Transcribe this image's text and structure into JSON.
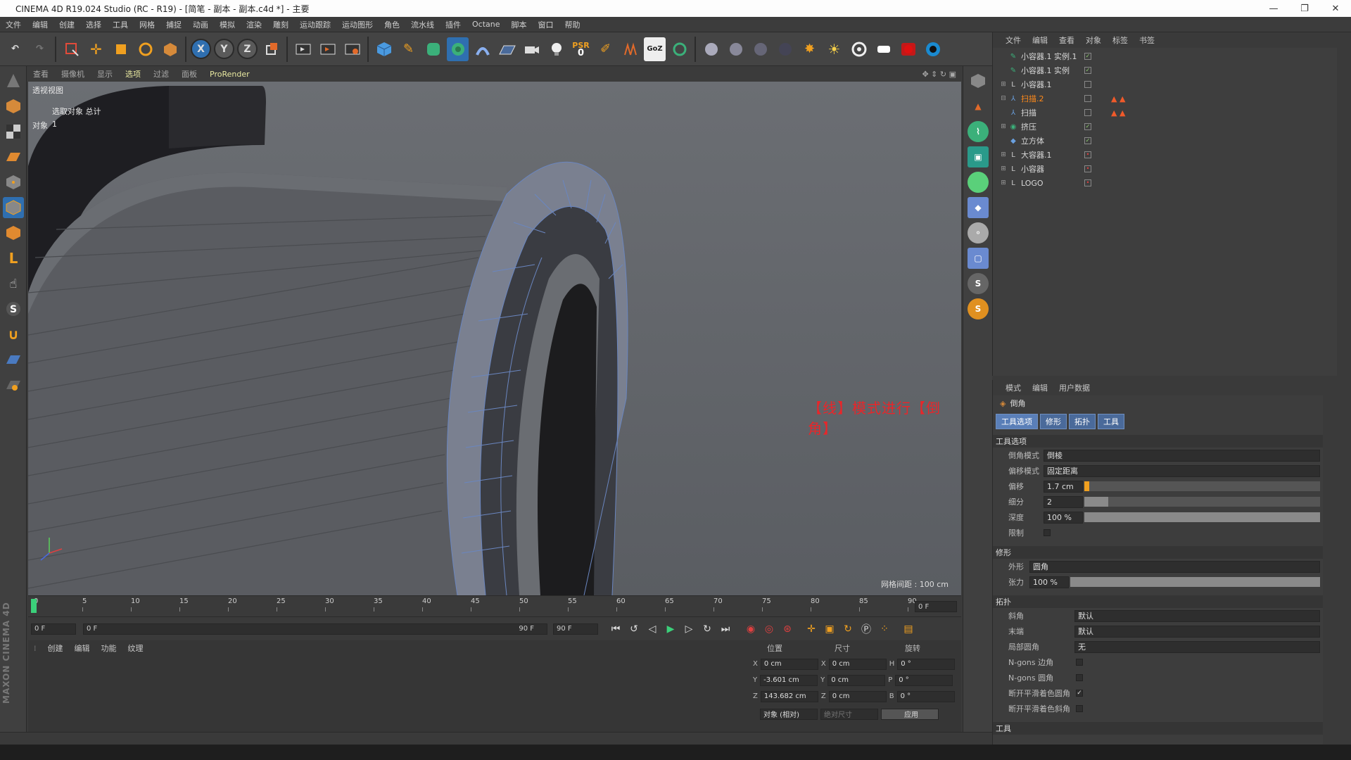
{
  "window": {
    "title": "CINEMA 4D R19.024 Studio (RC - R19) - [简笔 - 副本 - 副本.c4d *] - 主要",
    "min": "—",
    "max": "❐",
    "close": "✕"
  },
  "menu": [
    "文件",
    "编辑",
    "创建",
    "选择",
    "工具",
    "网格",
    "捕捉",
    "动画",
    "模拟",
    "渲染",
    "雕刻",
    "运动跟踪",
    "运动图形",
    "角色",
    "流水线",
    "插件",
    "Octane",
    "脚本",
    "窗口",
    "帮助"
  ],
  "toolbar": {
    "undo": "↶",
    "psr": "PSR",
    "psr_val": "0",
    "axis_x": "X",
    "axis_y": "Y",
    "axis_z": "Z",
    "goz": "GoZ"
  },
  "viewport_header": [
    "查看",
    "摄像机",
    "显示",
    "选项",
    "过滤",
    "面板",
    "ProRender"
  ],
  "viewport": {
    "name": "透视视图",
    "sel_info": "选取对象 总计",
    "obj_label": "对象",
    "obj_count": "1",
    "annotation": "【线】模式进行【倒角】",
    "grid_info": "网格间距 : 100 cm"
  },
  "object_panel": {
    "menu": [
      "文件",
      "编辑",
      "查看",
      "对象",
      "标签",
      "书签"
    ],
    "objects": [
      {
        "name": "小容器.1 实例.1",
        "hl": false,
        "tags": ""
      },
      {
        "name": "小容器.1 实例",
        "hl": false,
        "tags": ""
      },
      {
        "name": "小容器.1",
        "hl": false,
        "tags": ""
      },
      {
        "name": "扫描.2",
        "hl": true,
        "tags": "▲ ▲"
      },
      {
        "name": "扫描",
        "hl": false,
        "tags": "▲ ▲"
      },
      {
        "name": "挤压",
        "hl": false,
        "tags": ""
      },
      {
        "name": "立方体",
        "hl": false,
        "tags": ""
      },
      {
        "name": "大容器.1",
        "hl": false,
        "tags": ""
      },
      {
        "name": "小容器",
        "hl": false,
        "tags": ""
      },
      {
        "name": "LOGO",
        "hl": false,
        "tags": ""
      }
    ]
  },
  "attributes": {
    "menu": [
      "模式",
      "编辑",
      "用户数据"
    ],
    "tool": "倒角",
    "tabs": [
      "工具选项",
      "修形",
      "拓扑",
      "工具"
    ],
    "sect_tool": "工具选项",
    "bevel_mode_label": "倒角模式",
    "bevel_mode": "倒棱",
    "offset_mode_label": "偏移模式",
    "offset_mode": "固定距离",
    "offset_label": "偏移",
    "offset": "1.7 cm",
    "offset_fill": 0.02,
    "subdiv_label": "细分",
    "subdiv": "2",
    "subdiv_fill": 0.1,
    "depth_label": "深度",
    "depth": "100 %",
    "depth_fill": 1.0,
    "limit_label": "限制",
    "sect_shape": "修形",
    "shape_label": "外形",
    "shape": "圆角",
    "tension_label": "张力",
    "tension": "100 %",
    "tension_fill": 1.0,
    "sect_topo": "拓扑",
    "miter_label": "斜角",
    "miter": "默认",
    "end_label": "末端",
    "end": "默认",
    "partial_label": "局部圆角",
    "partial": "无",
    "ngons_corner": "N-gons 边角",
    "ngons_round": "N-gons 圆角",
    "break_phong_round": "断开平滑着色圆角",
    "break_phong_miter": "断开平滑着色斜角",
    "sect_tools": "工具"
  },
  "timeline": {
    "ticks": [
      "0",
      "5",
      "10",
      "15",
      "20",
      "25",
      "30",
      "35",
      "40",
      "45",
      "50",
      "55",
      "60",
      "65",
      "70",
      "75",
      "80",
      "85",
      "90"
    ],
    "current": "0 F",
    "start": "0 F",
    "range_start": "0 F",
    "range_end": "90 F",
    "end": "90 F"
  },
  "material_menu": [
    "创建",
    "编辑",
    "功能",
    "纹理"
  ],
  "coords": {
    "pos_head": "位置",
    "size_head": "尺寸",
    "rot_head": "旋转",
    "x": "0 cm",
    "y": "-3.601 cm",
    "z": "143.682 cm",
    "sx": "0 cm",
    "sy": "0 cm",
    "sz": "0 cm",
    "h": "0 °",
    "p": "0 °",
    "b": "0 °",
    "mode": "对象 (相对)",
    "size_mode": "绝对尺寸",
    "apply": "应用"
  },
  "brand": "MAXON CINEMA 4D",
  "colors": {
    "accent": "#2f6fb0",
    "highlight": "#ff8a1a",
    "annotation": "#e8262a"
  }
}
